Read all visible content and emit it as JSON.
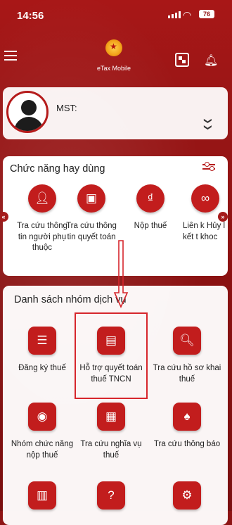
{
  "status_bar": {
    "time": "14:56",
    "battery": "76"
  },
  "header": {
    "title": "eTax Mobile"
  },
  "profile": {
    "mst_label": "MST:"
  },
  "favorites": {
    "title": "Chức năng hay dùng",
    "items": [
      {
        "label": "Tra cứu thông tin người phụ thuộc",
        "icon": "user-search-icon"
      },
      {
        "label": "Tra cứu thông tin quyết toán",
        "icon": "document-search-icon"
      },
      {
        "label": "Nộp thuế",
        "icon": "pay-tax-icon"
      },
      {
        "label": "Liên k Hủy l kết t khoc",
        "icon": "link-icon"
      }
    ]
  },
  "services": {
    "title": "Danh sách nhóm dịch vụ",
    "items": [
      {
        "label": "Đăng ký thuế",
        "icon": "register-tax-icon"
      },
      {
        "label": "Hỗ trợ quyết toán thuế TNCN",
        "icon": "settlement-support-icon"
      },
      {
        "label": "Tra cứu hồ sơ khai thuế",
        "icon": "search-file-icon"
      },
      {
        "label": "Nhóm chức năng nộp thuế",
        "icon": "tax-payment-group-icon"
      },
      {
        "label": "Tra cứu nghĩa vụ thuế",
        "icon": "tax-obligation-icon"
      },
      {
        "label": "Tra cứu thông báo",
        "icon": "notification-search-icon"
      },
      {
        "label": "",
        "icon": "calculator-icon"
      },
      {
        "label": "",
        "icon": "help-icon"
      },
      {
        "label": "",
        "icon": "settings-icon"
      }
    ]
  },
  "colors": {
    "primary": "#a81717",
    "highlight": "#d6262c"
  }
}
